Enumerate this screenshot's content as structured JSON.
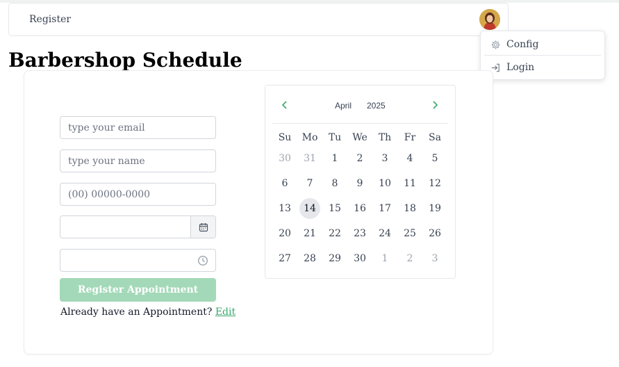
{
  "nav": {
    "register_label": "Register"
  },
  "user_menu": {
    "items": [
      {
        "label": "Config",
        "icon": "gear-icon"
      },
      {
        "label": "Login",
        "icon": "login-icon"
      }
    ]
  },
  "page": {
    "title": "Barbershop Schedule"
  },
  "form": {
    "email_placeholder": "type your email",
    "name_placeholder": "type your name",
    "phone_placeholder": "(00) 00000-0000",
    "date_value": "",
    "time_value": "",
    "submit_label": "Register Appointment",
    "already_text": "Already have an Appointment?",
    "edit_label": "Edit"
  },
  "calendar": {
    "month": "April",
    "year": "2025",
    "weekdays": [
      "Su",
      "Mo",
      "Tu",
      "We",
      "Th",
      "Fr",
      "Sa"
    ],
    "weeks": [
      [
        {
          "d": "30",
          "muted": true
        },
        {
          "d": "31",
          "muted": true
        },
        {
          "d": "1"
        },
        {
          "d": "2"
        },
        {
          "d": "3"
        },
        {
          "d": "4"
        },
        {
          "d": "5"
        }
      ],
      [
        {
          "d": "6"
        },
        {
          "d": "7"
        },
        {
          "d": "8"
        },
        {
          "d": "9"
        },
        {
          "d": "10"
        },
        {
          "d": "11"
        },
        {
          "d": "12"
        }
      ],
      [
        {
          "d": "13"
        },
        {
          "d": "14",
          "today": true
        },
        {
          "d": "15"
        },
        {
          "d": "16"
        },
        {
          "d": "17"
        },
        {
          "d": "18"
        },
        {
          "d": "19"
        }
      ],
      [
        {
          "d": "20"
        },
        {
          "d": "21"
        },
        {
          "d": "22"
        },
        {
          "d": "23"
        },
        {
          "d": "24"
        },
        {
          "d": "25"
        },
        {
          "d": "26"
        }
      ],
      [
        {
          "d": "27"
        },
        {
          "d": "28"
        },
        {
          "d": "29"
        },
        {
          "d": "30"
        },
        {
          "d": "1",
          "muted": true
        },
        {
          "d": "2",
          "muted": true
        },
        {
          "d": "3",
          "muted": true
        }
      ]
    ]
  },
  "colors": {
    "accent": "#3aa76d",
    "button_bg": "#a3d9b8",
    "border": "#d1d5db",
    "today_bg": "#e5e7eb"
  }
}
